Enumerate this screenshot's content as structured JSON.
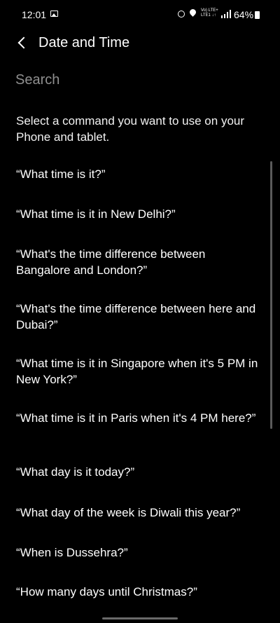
{
  "status_bar": {
    "time": "12:01",
    "network": "Vo) LTE+\nLTE1 ↓↑",
    "battery": "64%",
    "icons": [
      "gallery-icon",
      "alarm-icon",
      "location-icon",
      "signal-icon",
      "battery-icon"
    ]
  },
  "header": {
    "title": "Date and Time",
    "back_icon": "chevron-left-icon"
  },
  "search": {
    "placeholder": "Search",
    "value": ""
  },
  "intro": "Select a command you want to use on your Phone and tablet.",
  "commands": [
    "“What time is it?”",
    "“What time is it in New Delhi?”",
    "“What's the time difference between Bangalore and London?”",
    "“What's the time difference between here and Dubai?”",
    "“What time is it in Singapore when it's 5 PM in New York?”",
    "“What time is it in Paris when it's 4 PM here?”",
    "“What day is it today?”",
    "“What day of the week is Diwali this year?”",
    "“When is Dussehra?”",
    "“How many days until Christmas?”"
  ],
  "colors": {
    "background": "#000000",
    "text": "#ffffff",
    "placeholder": "#8f8f8f",
    "scrollbar": "#5a5a5a"
  }
}
